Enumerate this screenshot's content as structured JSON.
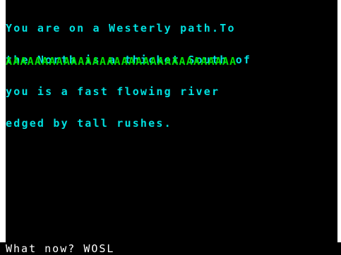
{
  "game": {
    "description_lines": [
      "You are on a Westerly path.To",
      "the North is a thicket.South of",
      "you is a fast flowing river",
      "edged by tall rushes."
    ],
    "separator": "AAAAAAAAAAAAAAAAAAAAAAAAAAAAAAAA",
    "prompt_label": "What now?",
    "command_input": "WOSL"
  },
  "colors": {
    "description": "#00e0e0",
    "separator": "#00e000",
    "prompt": "#ffffff",
    "background": "#000000",
    "border": "#ffffff"
  }
}
